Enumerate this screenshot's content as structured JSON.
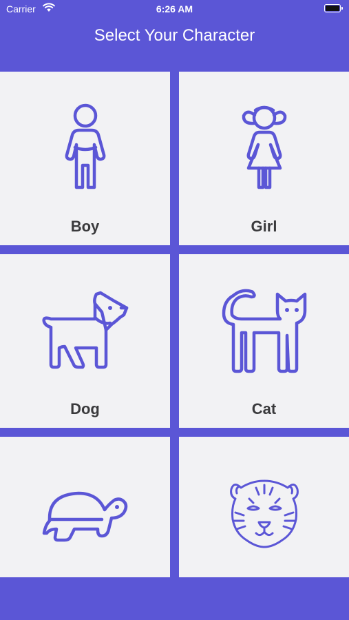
{
  "status_bar": {
    "carrier": "Carrier",
    "time": "6:26 AM"
  },
  "nav": {
    "title": "Select Your Character"
  },
  "characters": [
    {
      "label": "Boy",
      "icon": "boy-icon"
    },
    {
      "label": "Girl",
      "icon": "girl-icon"
    },
    {
      "label": "Dog",
      "icon": "dog-icon"
    },
    {
      "label": "Cat",
      "icon": "cat-icon"
    },
    {
      "label": "",
      "icon": "turtle-icon"
    },
    {
      "label": "",
      "icon": "tiger-icon"
    }
  ],
  "colors": {
    "accent": "#5B56D6",
    "card_background": "#F2F2F4",
    "label_text": "#3a3a3c"
  }
}
